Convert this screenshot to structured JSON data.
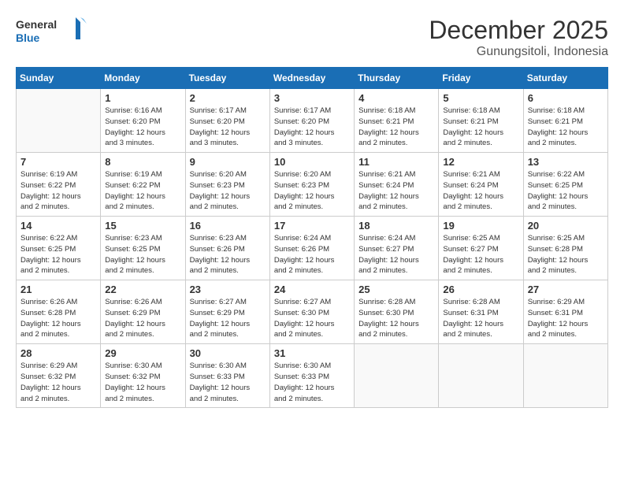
{
  "header": {
    "logo_line1": "General",
    "logo_line2": "Blue",
    "month": "December 2025",
    "location": "Gunungsitoli, Indonesia"
  },
  "days_of_week": [
    "Sunday",
    "Monday",
    "Tuesday",
    "Wednesday",
    "Thursday",
    "Friday",
    "Saturday"
  ],
  "weeks": [
    [
      {
        "day": "",
        "info": ""
      },
      {
        "day": "1",
        "info": "Sunrise: 6:16 AM\nSunset: 6:20 PM\nDaylight: 12 hours\nand 3 minutes."
      },
      {
        "day": "2",
        "info": "Sunrise: 6:17 AM\nSunset: 6:20 PM\nDaylight: 12 hours\nand 3 minutes."
      },
      {
        "day": "3",
        "info": "Sunrise: 6:17 AM\nSunset: 6:20 PM\nDaylight: 12 hours\nand 3 minutes."
      },
      {
        "day": "4",
        "info": "Sunrise: 6:18 AM\nSunset: 6:21 PM\nDaylight: 12 hours\nand 2 minutes."
      },
      {
        "day": "5",
        "info": "Sunrise: 6:18 AM\nSunset: 6:21 PM\nDaylight: 12 hours\nand 2 minutes."
      },
      {
        "day": "6",
        "info": "Sunrise: 6:18 AM\nSunset: 6:21 PM\nDaylight: 12 hours\nand 2 minutes."
      }
    ],
    [
      {
        "day": "7",
        "info": "Sunrise: 6:19 AM\nSunset: 6:22 PM\nDaylight: 12 hours\nand 2 minutes."
      },
      {
        "day": "8",
        "info": "Sunrise: 6:19 AM\nSunset: 6:22 PM\nDaylight: 12 hours\nand 2 minutes."
      },
      {
        "day": "9",
        "info": "Sunrise: 6:20 AM\nSunset: 6:23 PM\nDaylight: 12 hours\nand 2 minutes."
      },
      {
        "day": "10",
        "info": "Sunrise: 6:20 AM\nSunset: 6:23 PM\nDaylight: 12 hours\nand 2 minutes."
      },
      {
        "day": "11",
        "info": "Sunrise: 6:21 AM\nSunset: 6:24 PM\nDaylight: 12 hours\nand 2 minutes."
      },
      {
        "day": "12",
        "info": "Sunrise: 6:21 AM\nSunset: 6:24 PM\nDaylight: 12 hours\nand 2 minutes."
      },
      {
        "day": "13",
        "info": "Sunrise: 6:22 AM\nSunset: 6:25 PM\nDaylight: 12 hours\nand 2 minutes."
      }
    ],
    [
      {
        "day": "14",
        "info": "Sunrise: 6:22 AM\nSunset: 6:25 PM\nDaylight: 12 hours\nand 2 minutes."
      },
      {
        "day": "15",
        "info": "Sunrise: 6:23 AM\nSunset: 6:25 PM\nDaylight: 12 hours\nand 2 minutes."
      },
      {
        "day": "16",
        "info": "Sunrise: 6:23 AM\nSunset: 6:26 PM\nDaylight: 12 hours\nand 2 minutes."
      },
      {
        "day": "17",
        "info": "Sunrise: 6:24 AM\nSunset: 6:26 PM\nDaylight: 12 hours\nand 2 minutes."
      },
      {
        "day": "18",
        "info": "Sunrise: 6:24 AM\nSunset: 6:27 PM\nDaylight: 12 hours\nand 2 minutes."
      },
      {
        "day": "19",
        "info": "Sunrise: 6:25 AM\nSunset: 6:27 PM\nDaylight: 12 hours\nand 2 minutes."
      },
      {
        "day": "20",
        "info": "Sunrise: 6:25 AM\nSunset: 6:28 PM\nDaylight: 12 hours\nand 2 minutes."
      }
    ],
    [
      {
        "day": "21",
        "info": "Sunrise: 6:26 AM\nSunset: 6:28 PM\nDaylight: 12 hours\nand 2 minutes."
      },
      {
        "day": "22",
        "info": "Sunrise: 6:26 AM\nSunset: 6:29 PM\nDaylight: 12 hours\nand 2 minutes."
      },
      {
        "day": "23",
        "info": "Sunrise: 6:27 AM\nSunset: 6:29 PM\nDaylight: 12 hours\nand 2 minutes."
      },
      {
        "day": "24",
        "info": "Sunrise: 6:27 AM\nSunset: 6:30 PM\nDaylight: 12 hours\nand 2 minutes."
      },
      {
        "day": "25",
        "info": "Sunrise: 6:28 AM\nSunset: 6:30 PM\nDaylight: 12 hours\nand 2 minutes."
      },
      {
        "day": "26",
        "info": "Sunrise: 6:28 AM\nSunset: 6:31 PM\nDaylight: 12 hours\nand 2 minutes."
      },
      {
        "day": "27",
        "info": "Sunrise: 6:29 AM\nSunset: 6:31 PM\nDaylight: 12 hours\nand 2 minutes."
      }
    ],
    [
      {
        "day": "28",
        "info": "Sunrise: 6:29 AM\nSunset: 6:32 PM\nDaylight: 12 hours\nand 2 minutes."
      },
      {
        "day": "29",
        "info": "Sunrise: 6:30 AM\nSunset: 6:32 PM\nDaylight: 12 hours\nand 2 minutes."
      },
      {
        "day": "30",
        "info": "Sunrise: 6:30 AM\nSunset: 6:33 PM\nDaylight: 12 hours\nand 2 minutes."
      },
      {
        "day": "31",
        "info": "Sunrise: 6:30 AM\nSunset: 6:33 PM\nDaylight: 12 hours\nand 2 minutes."
      },
      {
        "day": "",
        "info": ""
      },
      {
        "day": "",
        "info": ""
      },
      {
        "day": "",
        "info": ""
      }
    ]
  ]
}
